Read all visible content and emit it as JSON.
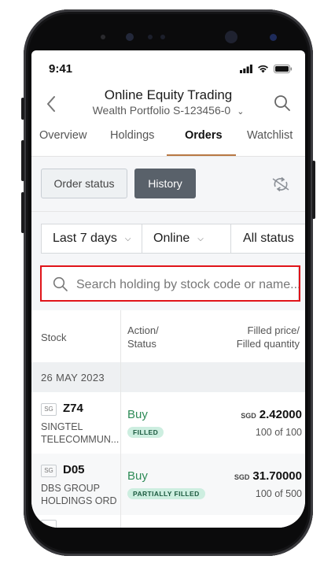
{
  "status_bar": {
    "time": "9:41"
  },
  "header": {
    "title": "Online Equity Trading",
    "subtitle": "Wealth Portfolio S-123456-0"
  },
  "tabs": [
    {
      "label": "Overview",
      "active": false
    },
    {
      "label": "Holdings",
      "active": false
    },
    {
      "label": "Orders",
      "active": true
    },
    {
      "label": "Watchlist",
      "active": false
    }
  ],
  "toggle": {
    "order_status_label": "Order status",
    "history_label": "History",
    "selected": "History"
  },
  "filters": {
    "period": "Last 7 days",
    "channel": "Online",
    "status": "All status"
  },
  "search": {
    "placeholder": "Search holding by stock code or name..."
  },
  "table": {
    "col_stock": "Stock",
    "col_action_1": "Action/",
    "col_action_2": "Status",
    "col_price_1": "Filled price/",
    "col_price_2": "Filled quantity",
    "date_group": "26 MAY 2023",
    "rows": [
      {
        "exchange": "SG",
        "code": "Z74",
        "name_1": "SINGTEL",
        "name_2": "TELECOMMUN...",
        "action": "Buy",
        "status": "FILLED",
        "currency": "SGD",
        "price": "2.42000",
        "quantity": "100 of 100"
      },
      {
        "exchange": "SG",
        "code": "D05",
        "name_1": "DBS GROUP",
        "name_2": "HOLDINGS ORD",
        "action": "Buy",
        "status": "PARTIALLY FILLED",
        "currency": "SGD",
        "price": "31.70000",
        "quantity": "100 of 500"
      }
    ]
  },
  "colors": {
    "accent": "#b87844",
    "buy": "#2e8b57",
    "badge_bg": "#cdeee0",
    "highlight": "#e0141a"
  },
  "icons": [
    "back-chevron-icon",
    "search-icon",
    "refresh-icon",
    "signal-icon",
    "wifi-icon",
    "battery-icon"
  ]
}
